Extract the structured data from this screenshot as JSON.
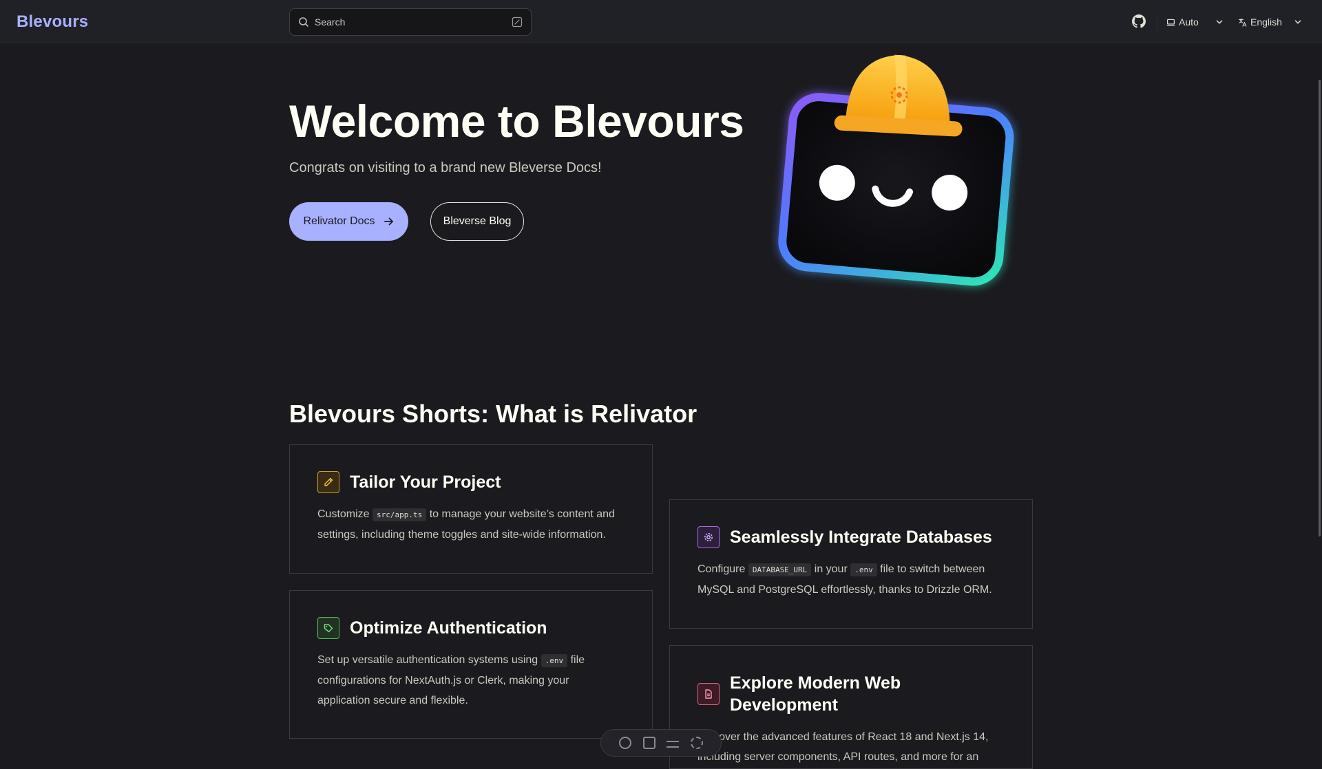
{
  "nav": {
    "brand": "Blevours",
    "search_label": "Search",
    "theme_label": "Auto",
    "language_label": "English",
    "github_icon": "github-icon"
  },
  "hero": {
    "title": "Welcome to Blevours",
    "tagline": "Congrats on visiting to a brand new Bleverse Docs!",
    "primary_button": "Relivator Docs",
    "secondary_button": "Bleverse Blog",
    "image": "mascot-with-hard-hat"
  },
  "features": {
    "heading": "Blevours Shorts: What is Relivator",
    "cards": [
      {
        "icon": "pencil-icon",
        "title": "Tailor Your Project",
        "text_before": "Customize ",
        "code": "src/app.ts",
        "text_after": " to manage your website’s content and settings, including theme toggles and site-wide information."
      },
      {
        "icon": "tag-icon",
        "title": "Optimize Authentication",
        "text_before": "Set up versatile authentication systems using ",
        "code": ".env",
        "text_after": " file configurations for NextAuth.js or Clerk, making your application secure and flexible."
      },
      {
        "icon": "gear-icon",
        "title": "Seamlessly Integrate Databases",
        "text_before": "Configure ",
        "code": "DATABASE_URL",
        "text_mid": " in your ",
        "code2": ".env",
        "text_after": " file to switch between MySQL and PostgreSQL effortlessly, thanks to Drizzle ORM."
      },
      {
        "icon": "document-icon",
        "title": "Explore Modern Web Development",
        "text": "Discover the advanced features of React 18 and Next.js 14, including server components, API routes, and more for an"
      }
    ]
  },
  "colors": {
    "accent": "#a8b1ff",
    "background": "#1b1b1f",
    "navbar": "#202127"
  }
}
